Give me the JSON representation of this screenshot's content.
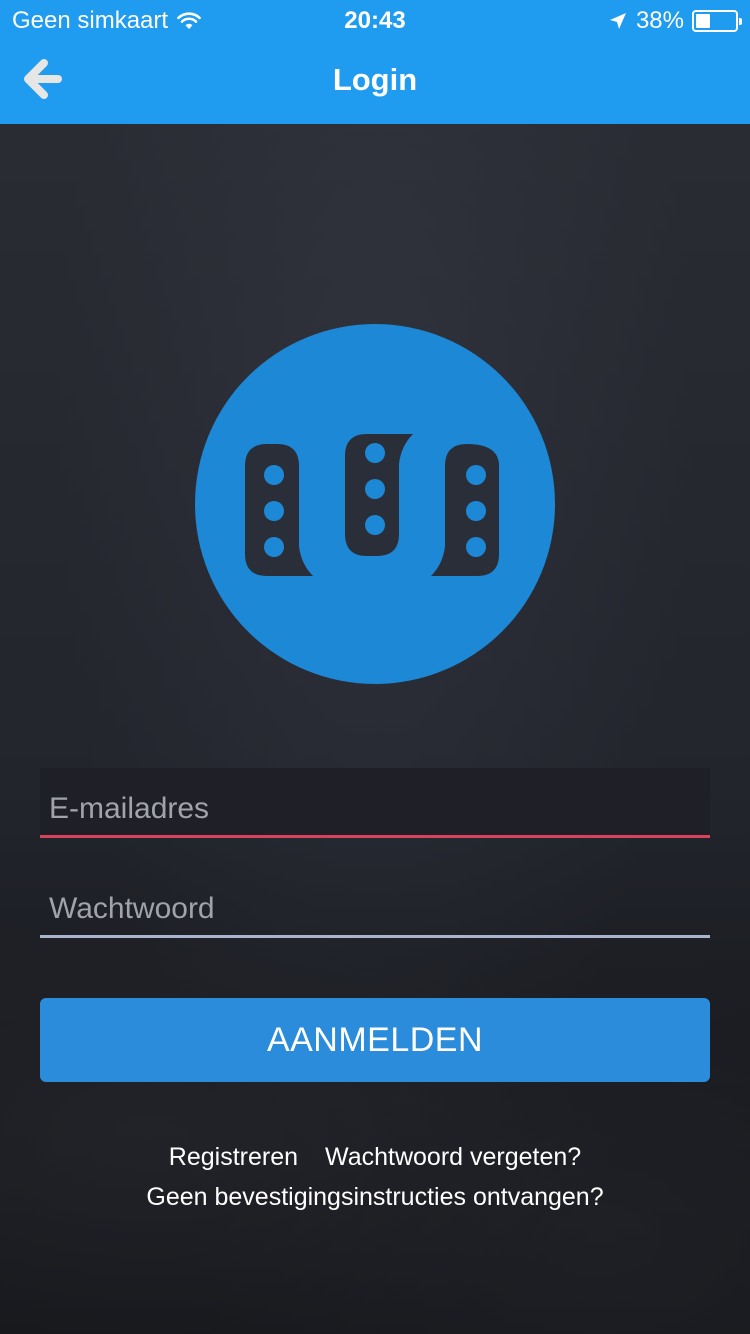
{
  "status_bar": {
    "carrier": "Geen simkaart",
    "time": "20:43",
    "battery": "38%",
    "battery_level": 0.38
  },
  "nav": {
    "back_icon": "arrow-left-icon",
    "title": "Login"
  },
  "logo": {
    "name": "app-logo"
  },
  "form": {
    "email_placeholder": "E-mailadres",
    "password_placeholder": "Wachtwoord",
    "submit_label": "AANMELDEN"
  },
  "links": {
    "register": "Registreren",
    "forgot_password": "Wachtwoord vergeten?",
    "no_confirmation": "Geen bevestigingsinstructies ontvangen?"
  },
  "colors": {
    "accent": "#1f9bf0",
    "button": "#2b8cdc",
    "email_underline": "#d8435c",
    "password_underline": "#aab4cf",
    "background": "#23252d"
  }
}
